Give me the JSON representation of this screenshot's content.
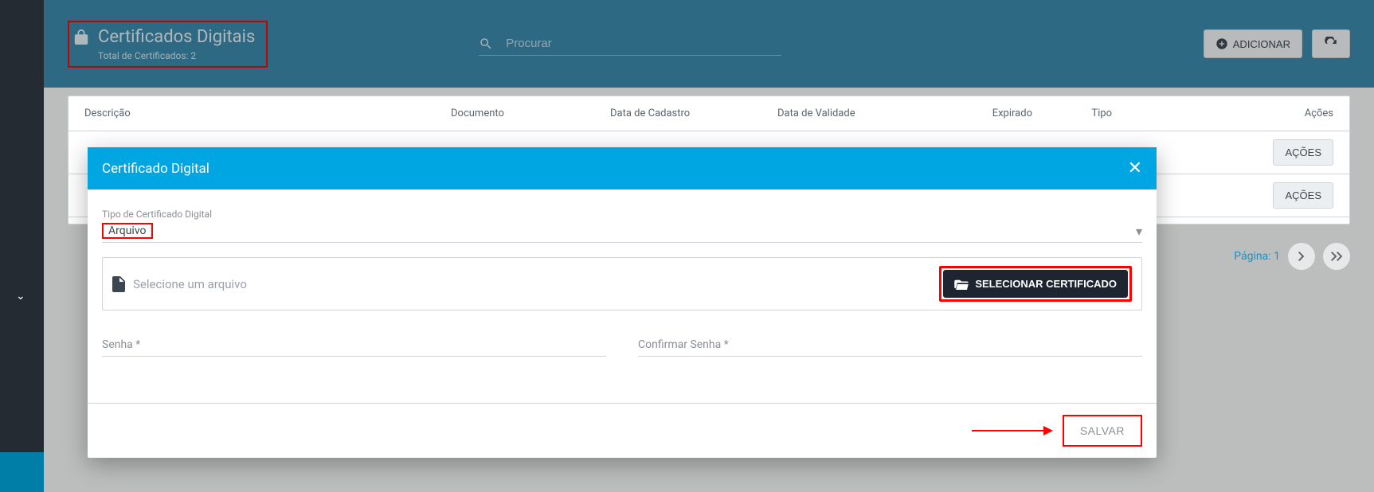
{
  "header": {
    "title": "Certificados Digitais",
    "subtitle": "Total de Certificados: 2",
    "search_placeholder": "Procurar",
    "add_label": "ADICIONAR"
  },
  "table": {
    "columns": {
      "descricao": "Descrição",
      "documento": "Documento",
      "data_cadastro": "Data de Cadastro",
      "data_validade": "Data de Validade",
      "expirado": "Expirado",
      "tipo": "Tipo",
      "acoes": "Ações"
    },
    "row_action_label": "AÇÕES"
  },
  "pagination": {
    "label": "Página: 1"
  },
  "modal": {
    "title": "Certificado Digital",
    "tipo_label": "Tipo de Certificado Digital",
    "tipo_value": "Arquivo",
    "file_placeholder": "Selecione um arquivo",
    "select_cert_label": "SELECIONAR CERTIFICADO",
    "senha_label": "Senha *",
    "confirmar_senha_label": "Confirmar Senha *",
    "save_label": "SALVAR"
  }
}
